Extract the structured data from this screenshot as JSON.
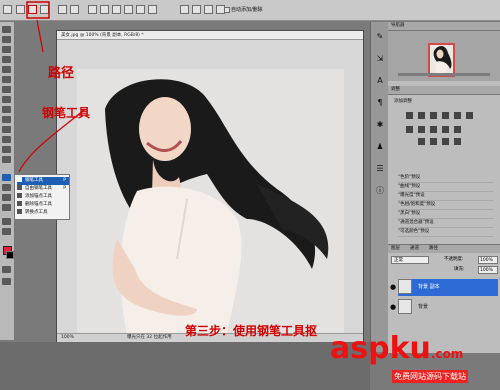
{
  "optionsbar": {
    "auto_add_delete": "自动添加/删除"
  },
  "document": {
    "title": "美女.jpg @ 100% (背景 副本, RGB/8) *",
    "status_zoom": "100%",
    "status_text": "曝光只在 32 位起作用"
  },
  "tool_flyout": {
    "items": [
      {
        "label": "钢笔工具",
        "shortcut": "P"
      },
      {
        "label": "自由钢笔工具",
        "shortcut": "P"
      },
      {
        "label": "添加锚点工具",
        "shortcut": ""
      },
      {
        "label": "删除锚点工具",
        "shortcut": ""
      },
      {
        "label": "转换点工具",
        "shortcut": ""
      }
    ]
  },
  "panels": {
    "navigator_tab": "导航器",
    "adjustments_tab": "调整",
    "add_adjustment": "添加调整",
    "presets": [
      "\"色阶\"预设",
      "\"曲线\"预设",
      "\"曝光度\"预设",
      "\"色相/饱和度\"预设",
      "\"黑白\"预设",
      "\"通道混合器\"预设",
      "\"可选颜色\"预设"
    ],
    "layers": {
      "tabs": [
        "图层",
        "通道",
        "路径"
      ],
      "blend_mode": "正常",
      "opacity_label": "不透明度:",
      "opacity_value": "100%",
      "fill_label": "填充:",
      "fill_value": "100%",
      "rows": [
        {
          "name": "背景 副本"
        },
        {
          "name": "背景"
        }
      ]
    }
  },
  "annotations": {
    "path": "路径",
    "pen_tool": "钢笔工具",
    "step": "第三步：使用钢笔工具抠"
  },
  "watermark": {
    "logo": "aspku",
    "logo_suffix": ".com",
    "sub": "免费网站源码下载站"
  },
  "colors": {
    "selection_blue": "#2d6ad6",
    "annotation_red": "#d10000",
    "logo_red": "#ee1111"
  }
}
